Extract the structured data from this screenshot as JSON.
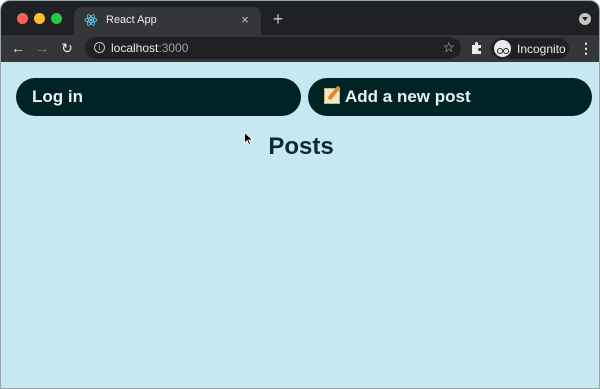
{
  "browser": {
    "tab": {
      "title": "React App",
      "close": "×"
    },
    "new_tab": "+",
    "url": {
      "host": "localhost",
      "port": ":3000"
    },
    "profile": "Incognito"
  },
  "page": {
    "login_label": "Log in",
    "add_post_label": "Add a new post",
    "posts_heading": "Posts"
  },
  "colors": {
    "page_bg": "#c6e8f2",
    "button_bg": "#002326",
    "heading": "#0e2a2d"
  }
}
